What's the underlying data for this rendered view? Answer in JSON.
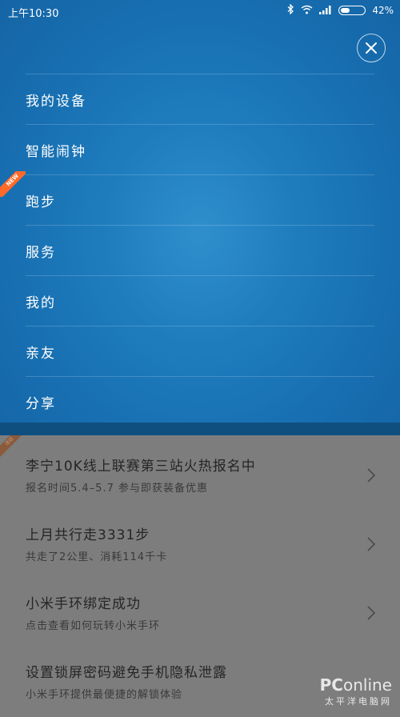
{
  "status_bar": {
    "time": "上午10:30",
    "battery_percent_label": "42%",
    "battery_level": 0.42
  },
  "drawer": {
    "menu": [
      {
        "label": "我的设备"
      },
      {
        "label": "智能闹钟"
      },
      {
        "label": "跑步",
        "badge": "NEW"
      },
      {
        "label": "服务"
      },
      {
        "label": "我的"
      },
      {
        "label": "亲友"
      },
      {
        "label": "分享"
      }
    ]
  },
  "feed": {
    "items": [
      {
        "title": "李宁10K线上联赛第三站火热报名中",
        "subtitle": "报名时间5.4–5.7 参与即获装备优惠",
        "ribbon": "活动"
      },
      {
        "title": "上月共行走3331步",
        "subtitle": "共走了2公里、消耗114千卡"
      },
      {
        "title": "小米手环绑定成功",
        "subtitle": "点击查看如何玩转小米手环"
      },
      {
        "title": "设置锁屏密码避免手机隐私泄露",
        "subtitle": "小米手环提供最便捷的解锁体验"
      }
    ]
  },
  "watermark": {
    "logo_pc": "PC",
    "logo_rest": "online",
    "sub": "太平洋电脑网"
  },
  "colors": {
    "drawer_blue": "#1e7cbd",
    "drawer_bottom": "#0f4f80",
    "dim_overlay": "#7d7d7d",
    "new_badge": "#ff6a2a"
  }
}
